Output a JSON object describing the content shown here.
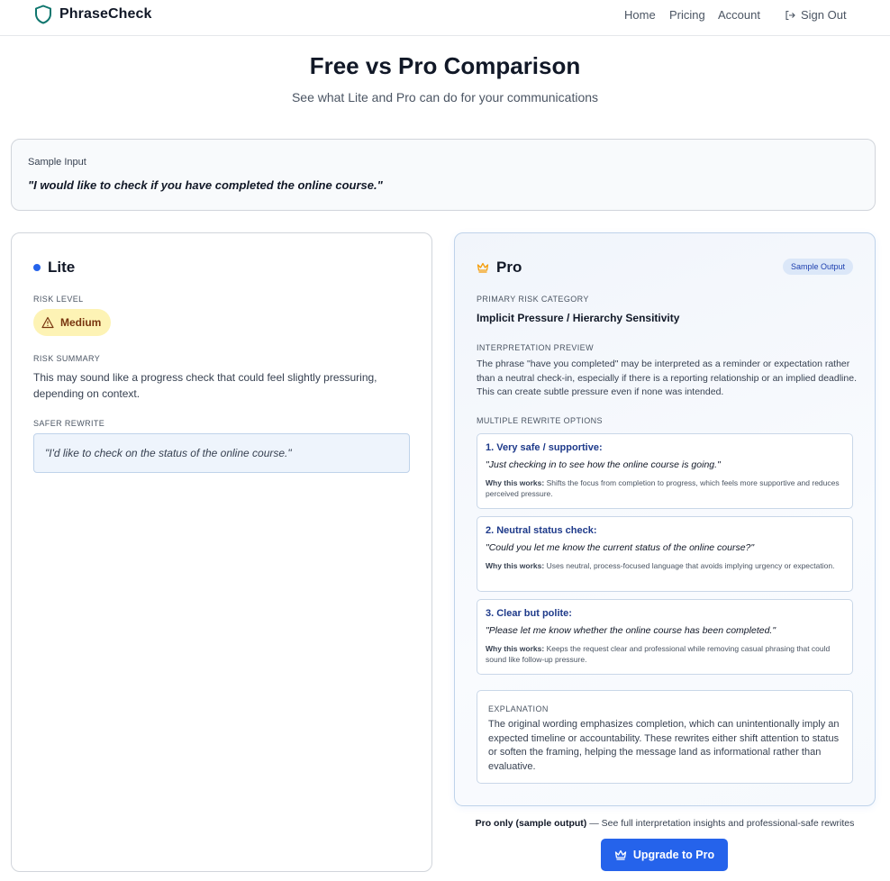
{
  "header": {
    "brand": "PhraseCheck",
    "nav": {
      "home": "Home",
      "pricing": "Pricing",
      "account": "Account",
      "sign_out": "Sign Out"
    }
  },
  "hero": {
    "title": "Free vs Pro Comparison",
    "subtitle": "See what Lite and Pro can do for your communications"
  },
  "sample_input": {
    "label": "Sample Input",
    "text": "\"I would like to check if you have completed the online course.\""
  },
  "lite": {
    "title": "Lite",
    "risk_level_label": "RISK LEVEL",
    "risk_level": "Medium",
    "risk_summary_label": "RISK SUMMARY",
    "risk_summary": "This may sound like a progress check that could feel slightly pressuring, depending on context.",
    "safer_rewrite_label": "SAFER REWRITE",
    "safer_rewrite": "\"I'd like to check on the status of the online course.\""
  },
  "pro": {
    "title": "Pro",
    "badge": "Sample Output",
    "primary_risk_label": "PRIMARY RISK CATEGORY",
    "primary_risk": "Implicit Pressure / Hierarchy Sensitivity",
    "interpretation_label": "INTERPRETATION PREVIEW",
    "interpretation": "The phrase \"have you completed\" may be interpreted as a reminder or expectation rather than a neutral check-in, especially if there is a reporting relationship or an implied deadline. This can create subtle pressure even if none was intended.",
    "rewrite_options_label": "MULTIPLE REWRITE OPTIONS",
    "why_label": "Why this works:",
    "options": [
      {
        "heading": "1. Very safe / supportive:",
        "quote": "\"Just checking in to see how the online course is going.\"",
        "why": "Shifts the focus from completion to progress, which feels more supportive and reduces perceived pressure."
      },
      {
        "heading": "2. Neutral status check:",
        "quote": "\"Could you let me know the current status of the online course?\"",
        "why": "Uses neutral, process-focused language that avoids implying urgency or expectation."
      },
      {
        "heading": "3. Clear but polite:",
        "quote": "\"Please let me know whether the online course has been completed.\"",
        "why": "Keeps the request clear and professional while removing casual phrasing that could sound like follow-up pressure."
      }
    ],
    "explanation_label": "EXPLANATION",
    "explanation": "The original wording emphasizes completion, which can unintentionally imply an expected timeline or accountability. These rewrites either shift attention to status or soften the framing, helping the message land as informational rather than evaluative."
  },
  "footer_note": {
    "bold": "Pro only (sample output)",
    "rest": " — See full interpretation insights and professional-safe rewrites"
  },
  "upgrade_button": "Upgrade to Pro",
  "colors": {
    "accent": "#2563eb",
    "brand_green": "#0f766e",
    "risk_medium_bg": "#fdf3b5",
    "crown": "#f59e0b"
  },
  "icons": {
    "logo": "shield-icon",
    "sign_out": "sign-out-icon",
    "warning": "warning-triangle-icon",
    "pro": "crown-icon"
  }
}
